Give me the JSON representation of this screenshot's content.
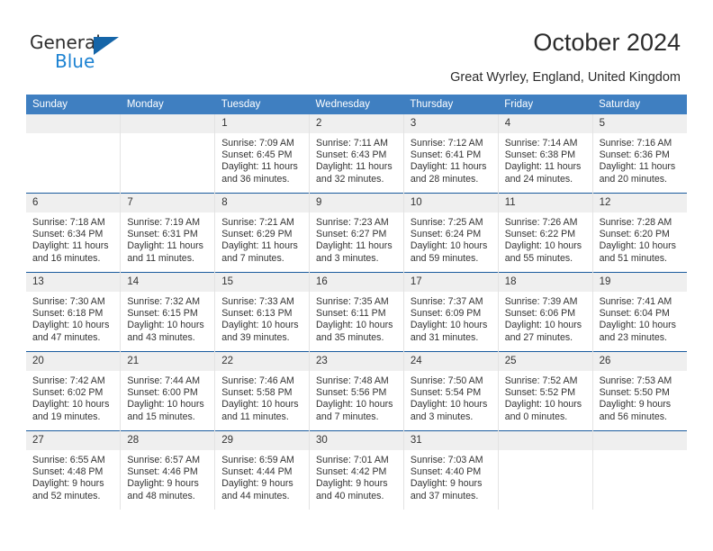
{
  "brand": {
    "word_one": "General",
    "word_two": "Blue",
    "triangle_icon": "triangle-logo-icon"
  },
  "header": {
    "title": "October 2024",
    "subtitle": "Great Wyrley, England, United Kingdom"
  },
  "colors": {
    "header_blue": "#3f7fc1",
    "rule_blue": "#1a5b9e",
    "daynum_band": "#efefef",
    "brand_blue": "#1c82d2",
    "brand_triangle": "#1565a8"
  },
  "calendar": {
    "day_names": [
      "Sunday",
      "Monday",
      "Tuesday",
      "Wednesday",
      "Thursday",
      "Friday",
      "Saturday"
    ],
    "weeks": [
      [
        {
          "day": "",
          "lines": []
        },
        {
          "day": "",
          "lines": []
        },
        {
          "day": "1",
          "lines": [
            "Sunrise: 7:09 AM",
            "Sunset: 6:45 PM",
            "Daylight: 11 hours",
            "and 36 minutes."
          ]
        },
        {
          "day": "2",
          "lines": [
            "Sunrise: 7:11 AM",
            "Sunset: 6:43 PM",
            "Daylight: 11 hours",
            "and 32 minutes."
          ]
        },
        {
          "day": "3",
          "lines": [
            "Sunrise: 7:12 AM",
            "Sunset: 6:41 PM",
            "Daylight: 11 hours",
            "and 28 minutes."
          ]
        },
        {
          "day": "4",
          "lines": [
            "Sunrise: 7:14 AM",
            "Sunset: 6:38 PM",
            "Daylight: 11 hours",
            "and 24 minutes."
          ]
        },
        {
          "day": "5",
          "lines": [
            "Sunrise: 7:16 AM",
            "Sunset: 6:36 PM",
            "Daylight: 11 hours",
            "and 20 minutes."
          ]
        }
      ],
      [
        {
          "day": "6",
          "lines": [
            "Sunrise: 7:18 AM",
            "Sunset: 6:34 PM",
            "Daylight: 11 hours",
            "and 16 minutes."
          ]
        },
        {
          "day": "7",
          "lines": [
            "Sunrise: 7:19 AM",
            "Sunset: 6:31 PM",
            "Daylight: 11 hours",
            "and 11 minutes."
          ]
        },
        {
          "day": "8",
          "lines": [
            "Sunrise: 7:21 AM",
            "Sunset: 6:29 PM",
            "Daylight: 11 hours",
            "and 7 minutes."
          ]
        },
        {
          "day": "9",
          "lines": [
            "Sunrise: 7:23 AM",
            "Sunset: 6:27 PM",
            "Daylight: 11 hours",
            "and 3 minutes."
          ]
        },
        {
          "day": "10",
          "lines": [
            "Sunrise: 7:25 AM",
            "Sunset: 6:24 PM",
            "Daylight: 10 hours",
            "and 59 minutes."
          ]
        },
        {
          "day": "11",
          "lines": [
            "Sunrise: 7:26 AM",
            "Sunset: 6:22 PM",
            "Daylight: 10 hours",
            "and 55 minutes."
          ]
        },
        {
          "day": "12",
          "lines": [
            "Sunrise: 7:28 AM",
            "Sunset: 6:20 PM",
            "Daylight: 10 hours",
            "and 51 minutes."
          ]
        }
      ],
      [
        {
          "day": "13",
          "lines": [
            "Sunrise: 7:30 AM",
            "Sunset: 6:18 PM",
            "Daylight: 10 hours",
            "and 47 minutes."
          ]
        },
        {
          "day": "14",
          "lines": [
            "Sunrise: 7:32 AM",
            "Sunset: 6:15 PM",
            "Daylight: 10 hours",
            "and 43 minutes."
          ]
        },
        {
          "day": "15",
          "lines": [
            "Sunrise: 7:33 AM",
            "Sunset: 6:13 PM",
            "Daylight: 10 hours",
            "and 39 minutes."
          ]
        },
        {
          "day": "16",
          "lines": [
            "Sunrise: 7:35 AM",
            "Sunset: 6:11 PM",
            "Daylight: 10 hours",
            "and 35 minutes."
          ]
        },
        {
          "day": "17",
          "lines": [
            "Sunrise: 7:37 AM",
            "Sunset: 6:09 PM",
            "Daylight: 10 hours",
            "and 31 minutes."
          ]
        },
        {
          "day": "18",
          "lines": [
            "Sunrise: 7:39 AM",
            "Sunset: 6:06 PM",
            "Daylight: 10 hours",
            "and 27 minutes."
          ]
        },
        {
          "day": "19",
          "lines": [
            "Sunrise: 7:41 AM",
            "Sunset: 6:04 PM",
            "Daylight: 10 hours",
            "and 23 minutes."
          ]
        }
      ],
      [
        {
          "day": "20",
          "lines": [
            "Sunrise: 7:42 AM",
            "Sunset: 6:02 PM",
            "Daylight: 10 hours",
            "and 19 minutes."
          ]
        },
        {
          "day": "21",
          "lines": [
            "Sunrise: 7:44 AM",
            "Sunset: 6:00 PM",
            "Daylight: 10 hours",
            "and 15 minutes."
          ]
        },
        {
          "day": "22",
          "lines": [
            "Sunrise: 7:46 AM",
            "Sunset: 5:58 PM",
            "Daylight: 10 hours",
            "and 11 minutes."
          ]
        },
        {
          "day": "23",
          "lines": [
            "Sunrise: 7:48 AM",
            "Sunset: 5:56 PM",
            "Daylight: 10 hours",
            "and 7 minutes."
          ]
        },
        {
          "day": "24",
          "lines": [
            "Sunrise: 7:50 AM",
            "Sunset: 5:54 PM",
            "Daylight: 10 hours",
            "and 3 minutes."
          ]
        },
        {
          "day": "25",
          "lines": [
            "Sunrise: 7:52 AM",
            "Sunset: 5:52 PM",
            "Daylight: 10 hours",
            "and 0 minutes."
          ]
        },
        {
          "day": "26",
          "lines": [
            "Sunrise: 7:53 AM",
            "Sunset: 5:50 PM",
            "Daylight: 9 hours",
            "and 56 minutes."
          ]
        }
      ],
      [
        {
          "day": "27",
          "lines": [
            "Sunrise: 6:55 AM",
            "Sunset: 4:48 PM",
            "Daylight: 9 hours",
            "and 52 minutes."
          ]
        },
        {
          "day": "28",
          "lines": [
            "Sunrise: 6:57 AM",
            "Sunset: 4:46 PM",
            "Daylight: 9 hours",
            "and 48 minutes."
          ]
        },
        {
          "day": "29",
          "lines": [
            "Sunrise: 6:59 AM",
            "Sunset: 4:44 PM",
            "Daylight: 9 hours",
            "and 44 minutes."
          ]
        },
        {
          "day": "30",
          "lines": [
            "Sunrise: 7:01 AM",
            "Sunset: 4:42 PM",
            "Daylight: 9 hours",
            "and 40 minutes."
          ]
        },
        {
          "day": "31",
          "lines": [
            "Sunrise: 7:03 AM",
            "Sunset: 4:40 PM",
            "Daylight: 9 hours",
            "and 37 minutes."
          ]
        },
        {
          "day": "",
          "lines": []
        },
        {
          "day": "",
          "lines": []
        }
      ]
    ]
  }
}
